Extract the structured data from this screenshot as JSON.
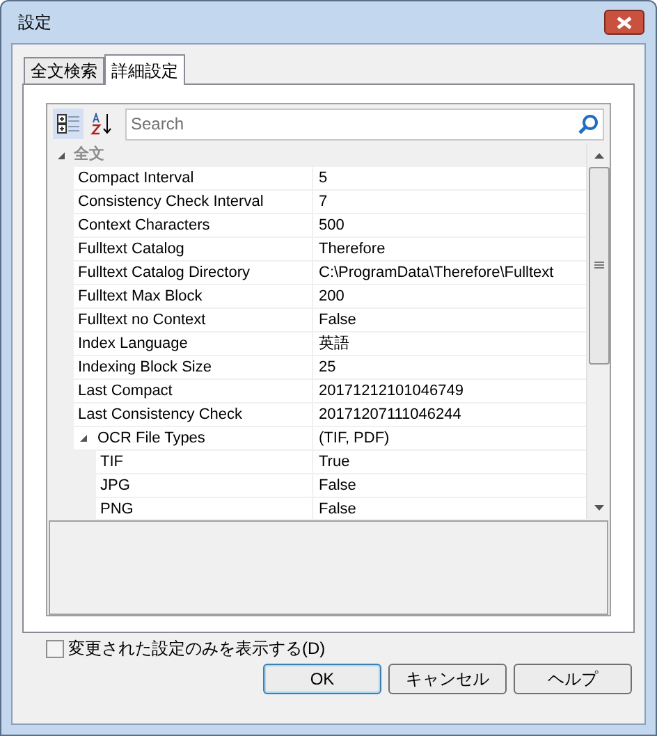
{
  "window": {
    "title": "設定"
  },
  "tabs": [
    {
      "label": "全文検索",
      "selected": false
    },
    {
      "label": "詳細設定",
      "selected": true
    }
  ],
  "toolbar": {
    "categorized_selected": true,
    "alphabetical_selected": false
  },
  "search": {
    "placeholder": "Search"
  },
  "categories": [
    {
      "name": "全文",
      "expanded": true,
      "children": [
        {
          "name": "Compact Interval",
          "value": "5"
        },
        {
          "name": "Consistency Check Interval",
          "value": "7"
        },
        {
          "name": "Context Characters",
          "value": "500"
        },
        {
          "name": "Fulltext Catalog",
          "value": "Therefore"
        },
        {
          "name": "Fulltext Catalog Directory",
          "value": "C:\\ProgramData\\Therefore\\Fulltext"
        },
        {
          "name": "Fulltext Max Block",
          "value": "200"
        },
        {
          "name": "Fulltext no Context",
          "value": "False"
        },
        {
          "name": "Index Language",
          "value": "英語"
        },
        {
          "name": "Indexing Block Size",
          "value": "25"
        },
        {
          "name": "Last Compact",
          "value": "20171212101046749"
        },
        {
          "name": "Last Consistency Check",
          "value": "20171207111046244"
        },
        {
          "name": "OCR File Types",
          "value": "(TIF, PDF)",
          "expanded": true,
          "children": [
            {
              "name": "TIF",
              "value": "True"
            },
            {
              "name": "JPG",
              "value": "False"
            },
            {
              "name": "PNG",
              "value": "False"
            }
          ]
        }
      ]
    }
  ],
  "show_changed_only": {
    "label": "変更された設定のみを表示する(D)",
    "checked": false
  },
  "buttons": [
    {
      "label": "OK",
      "default": true
    },
    {
      "label": "キャンセル",
      "default": false
    },
    {
      "label": "ヘルプ",
      "default": false
    }
  ]
}
